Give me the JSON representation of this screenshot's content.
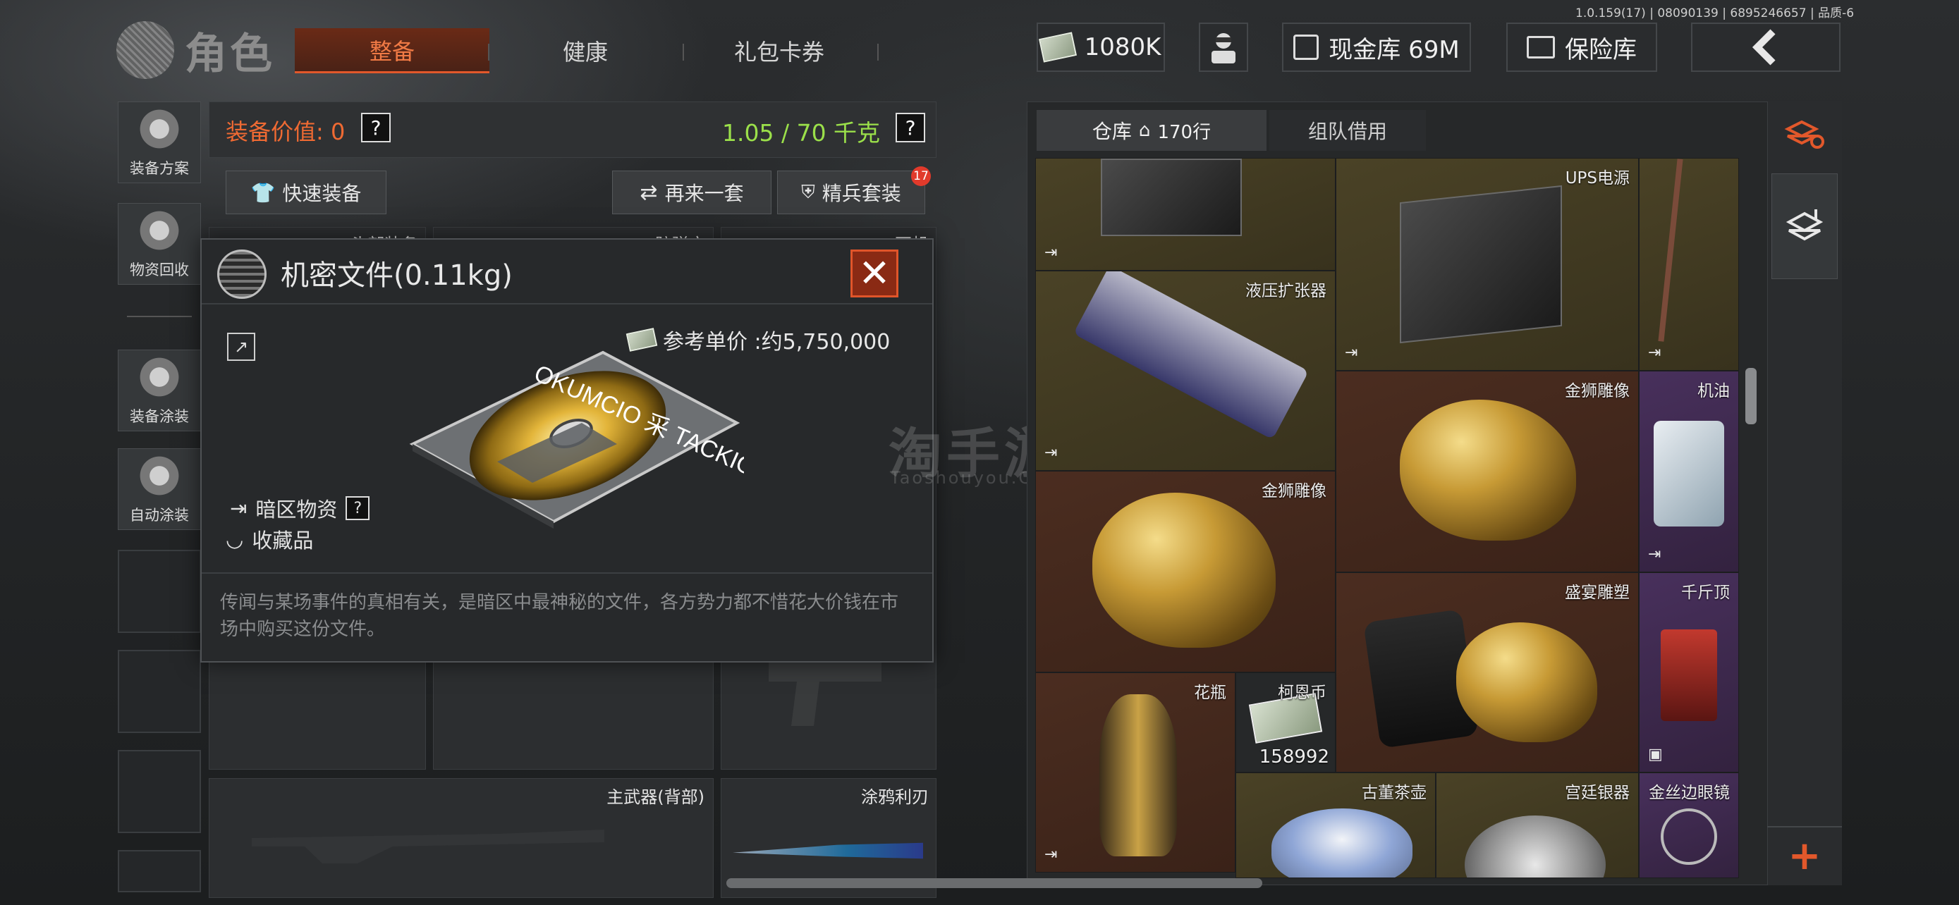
{
  "version": "1.0.159(17) | 08090139 | 6895246657 | 品质-6",
  "header": {
    "title": "角色",
    "tabs": [
      {
        "label": "整备",
        "active": true
      },
      {
        "label": "健康",
        "active": false
      },
      {
        "label": "礼包卡券",
        "active": false
      }
    ],
    "currency": "1080K",
    "cash_vault": "现金库 69M",
    "safe": "保险库",
    "back_icon": "chevron-left-icon"
  },
  "sidebar": {
    "items": [
      {
        "label": "装备方案",
        "icon": "helmet-plan-icon"
      },
      {
        "label": "物资回收",
        "icon": "recycle-mascot-icon"
      },
      {
        "label": "装备涂装",
        "icon": "helmet-paint-icon"
      },
      {
        "label": "自动涂装",
        "icon": "brush-gear-icon"
      }
    ]
  },
  "loadout": {
    "value_label": "装备价值: 0",
    "weight": "1.05 / 70 千克",
    "help": "?",
    "quick_equip": "快速装备",
    "reroll": "再来一套",
    "elite_set": "精兵套装",
    "elite_badge": "17",
    "slots": {
      "head": "头部装备",
      "armor": "防弹衣",
      "ear": "耳机",
      "primary_back": "主武器(背部)",
      "melee": "涂鸦利刃"
    }
  },
  "popup": {
    "title": "机密文件(0.11kg)",
    "close": "✕",
    "ref_price": "参考单价 :约5,750,000",
    "tag1": "暗区物资",
    "tag1_help": "?",
    "tag2": "收藏品",
    "description": "传闻与某场事件的真相有关，是暗区中最神秘的文件，各方势力都不惜花大价钱在市场中购买这份文件。",
    "disk_text": "OKUMCIO 采 TACKIO"
  },
  "watermark": {
    "cn": "淘手游",
    "en": "Taoshouyou.Com"
  },
  "warehouse": {
    "tab_storage": "仓库",
    "rows": "170行",
    "tab_team": "组队借用",
    "items": [
      {
        "name": "",
        "key": "top-safe"
      },
      {
        "name": "UPS电源",
        "key": "ups"
      },
      {
        "name": "",
        "key": "rod"
      },
      {
        "name": "液压扩张器",
        "key": "hydraulic"
      },
      {
        "name": "金狮雕像",
        "key": "lion1"
      },
      {
        "name": "机油",
        "key": "oil"
      },
      {
        "name": "金狮雕像",
        "key": "lion2"
      },
      {
        "name": "盛宴雕塑",
        "key": "feast"
      },
      {
        "name": "千斤顶",
        "key": "jack"
      },
      {
        "name": "花瓶",
        "key": "vase"
      },
      {
        "name": "柯恩币",
        "key": "coin",
        "count": "158992"
      },
      {
        "name": "古董茶壶",
        "key": "teapot"
      },
      {
        "name": "宫廷银器",
        "key": "silver"
      },
      {
        "name": "金丝边眼镜",
        "key": "glasses"
      }
    ],
    "add": "+"
  }
}
